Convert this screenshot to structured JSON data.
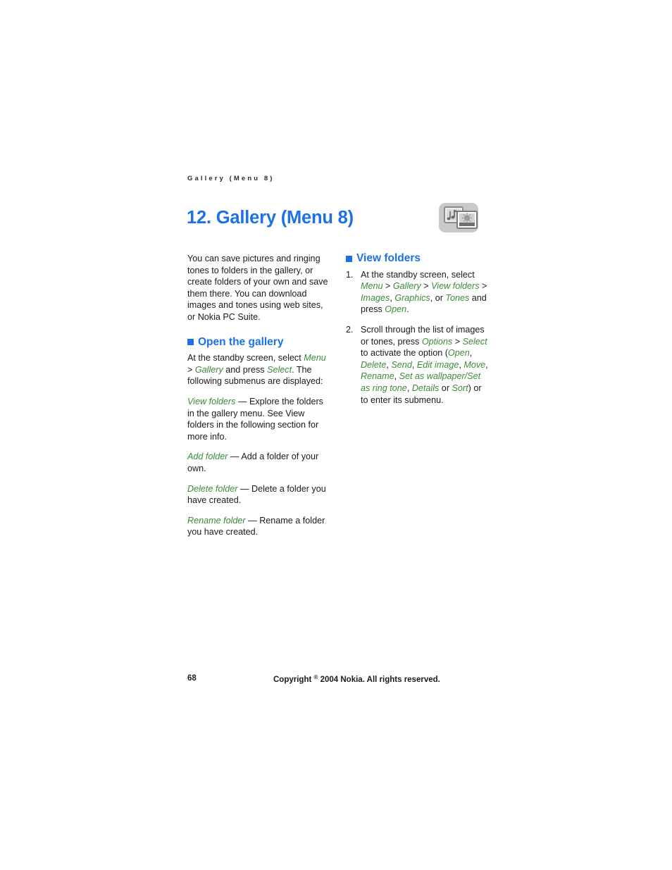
{
  "document": {
    "running_header": "Gallery (Menu 8)",
    "chapter_title": "12. Gallery (Menu 8)",
    "chapter_icon_name": "gallery-icon"
  },
  "intro": {
    "text": "You can save pictures and ringing tones to folders in the gallery, or create folders of your own and save them there. You can download images and tones using web sites, or Nokia PC Suite."
  },
  "open_gallery": {
    "heading": "Open the gallery",
    "intro_lead": "At the standby screen, select ",
    "intro_menu": "Menu",
    "intro_gt": " > ",
    "intro_gallery": "Gallery",
    "intro_mid": " and press ",
    "intro_select": "Select",
    "intro_tail": ". The following submenus are displayed:",
    "items": [
      {
        "term": "View folders",
        "dash": " — ",
        "desc": "Explore the folders in the gallery menu. See View folders in the following section for more info."
      },
      {
        "term": "Add folder",
        "dash": " — ",
        "desc": "Add a folder of your own."
      },
      {
        "term": "Delete folder",
        "dash": " — ",
        "desc": "Delete a folder you have created."
      },
      {
        "term": "Rename folder",
        "dash": " — ",
        "desc": "Rename a folder you have created."
      }
    ]
  },
  "view_folders": {
    "heading": "View folders",
    "steps": [
      {
        "number": "1.",
        "part_a": "At the standby screen, select ",
        "ui_menu": "Menu",
        "sep1": " > ",
        "ui_gallery": "Gallery",
        "sep2": " > ",
        "ui_view_folders": "View folders",
        "sep3": " > ",
        "ui_images": "Images",
        "comma1": ", ",
        "ui_graphics": "Graphics",
        "part_b": ", or ",
        "ui_tones": "Tones",
        "part_c": " and press ",
        "ui_open": "Open",
        "part_d": "."
      },
      {
        "number": "2.",
        "part_a": "Scroll through the list of images or tones, press ",
        "ui_options": "Options",
        "sep1": " > ",
        "ui_select": "Select",
        "part_b": " to activate the option (",
        "ui_open": "Open",
        "c1": ", ",
        "ui_delete": "Delete",
        "c2": ", ",
        "ui_send": "Send",
        "c3": ", ",
        "ui_edit_image": "Edit image",
        "c4": ", ",
        "ui_move": "Move",
        "c5": ", ",
        "ui_rename": "Rename",
        "c6": ", ",
        "ui_set_as_wallpaper": "Set as wallpaper",
        "slash": "/",
        "ui_set_as_ring_tone": "Set as ring tone",
        "c7": ", ",
        "ui_details": "Details",
        "part_c": " or ",
        "ui_sort": "Sort",
        "part_d": ") or to enter its submenu."
      }
    ]
  },
  "footer": {
    "page_number": "68",
    "copyright_pre": "Copyright ",
    "copyright_symbol": "®",
    "copyright_post": " 2004 Nokia. All rights reserved."
  },
  "colors": {
    "heading_blue": "#1c71e8",
    "ui_green": "#3a8a3a",
    "body_text": "#1a1a1a"
  }
}
